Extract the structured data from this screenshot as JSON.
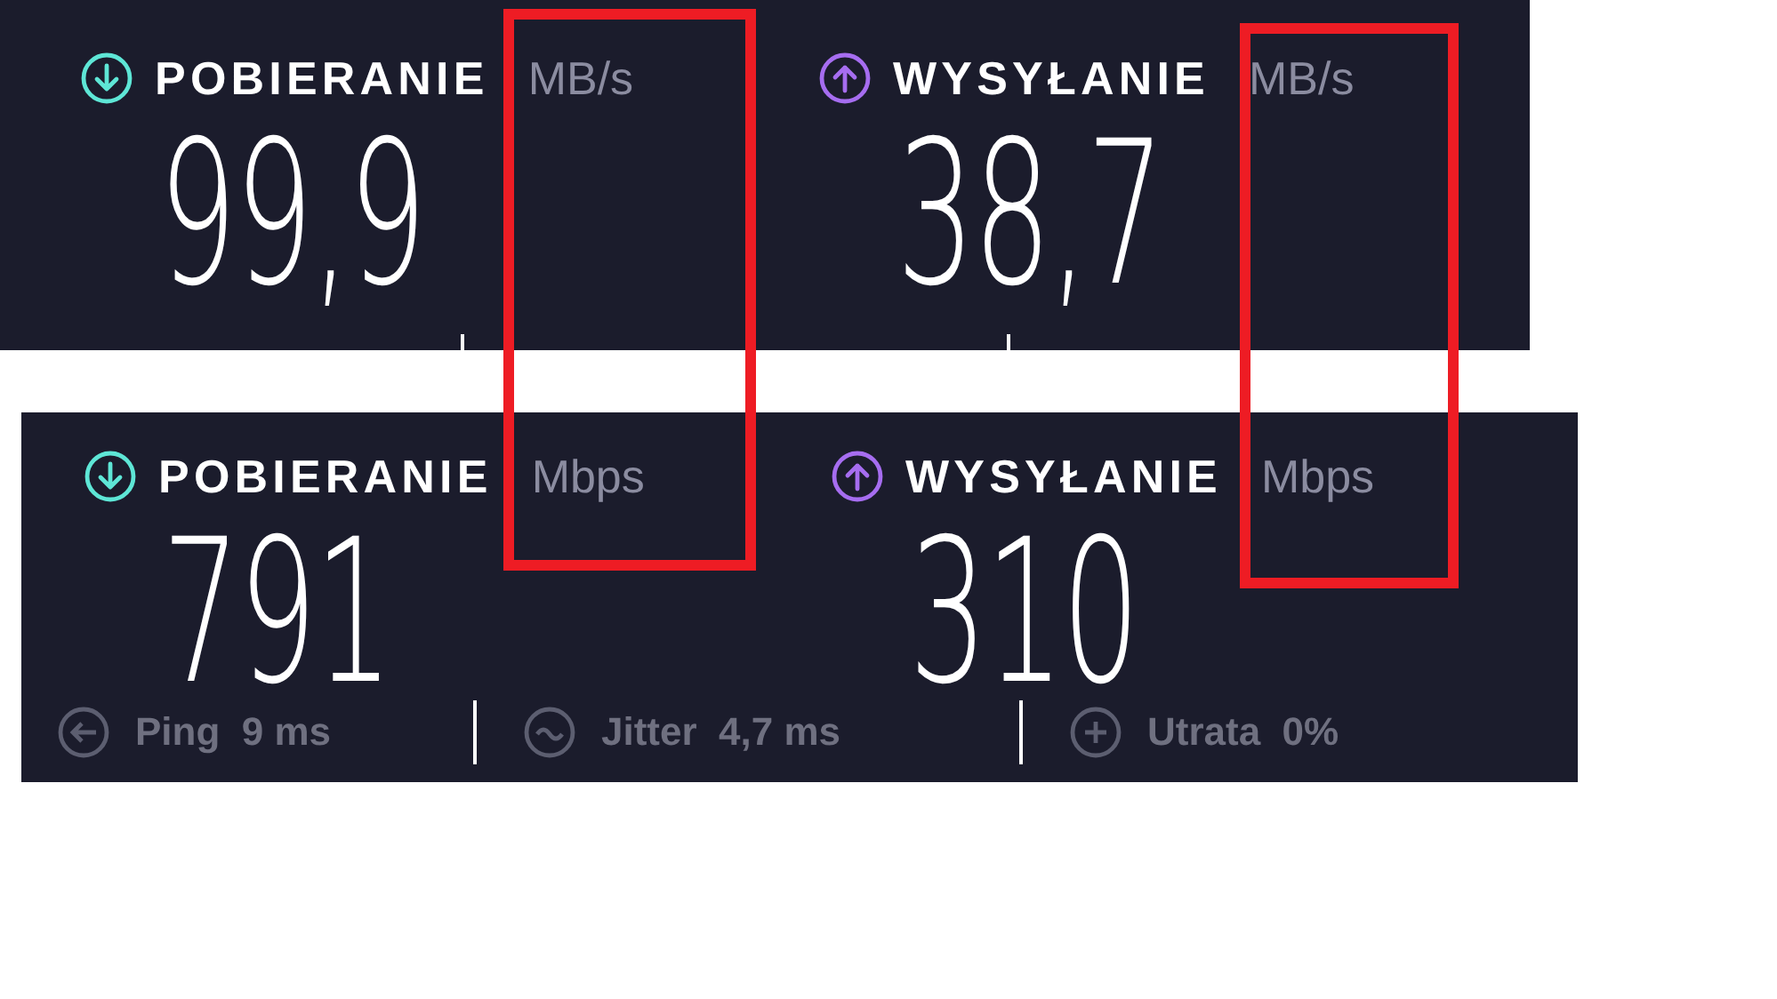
{
  "panels": [
    {
      "results": [
        {
          "kind": "download",
          "label": "POBIERANIE",
          "unit": "MB/s",
          "value": "99,9"
        },
        {
          "kind": "upload",
          "label": "WYSYŁANIE",
          "unit": "MB/s",
          "value": "38,7"
        }
      ]
    },
    {
      "results": [
        {
          "kind": "download",
          "label": "POBIERANIE",
          "unit": "Mbps",
          "value": "791"
        },
        {
          "kind": "upload",
          "label": "WYSYŁANIE",
          "unit": "Mbps",
          "value": "310"
        }
      ],
      "stats": [
        {
          "kind": "ping",
          "label": "Ping",
          "value": "9 ms"
        },
        {
          "kind": "jitter",
          "label": "Jitter",
          "value": "4,7 ms"
        },
        {
          "kind": "loss",
          "label": "Utrata",
          "value": "0%"
        }
      ]
    }
  ],
  "highlights": [
    {
      "kind": "rectangle"
    },
    {
      "kind": "rectangle"
    }
  ]
}
